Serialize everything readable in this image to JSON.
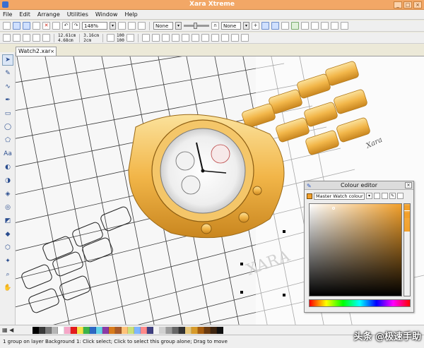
{
  "window": {
    "title": "Xara Xtreme",
    "controls": [
      "_",
      "□",
      "×"
    ]
  },
  "menu": [
    "File",
    "Edit",
    "Arrange",
    "Utilities",
    "Window",
    "Help"
  ],
  "toolbar1": {
    "zoom": "148%",
    "fill_a": "None",
    "fill_b": "None"
  },
  "toolbar2": {
    "x": "12.61cm",
    "y": "4.68cm",
    "w": "3.16cm",
    "h": "2cm",
    "sx": "100",
    "sy": "100"
  },
  "document_tab": {
    "label": "Watch2.xar",
    "close": "×"
  },
  "colour_editor": {
    "title": "Colour editor",
    "colour_name": "Master Watch colour",
    "close": "×"
  },
  "canvas": {
    "signature": "Xara",
    "watermark_text": "XARA"
  },
  "status": "1 group on layer Background 1: Click select; Click to select this group alone; Drag to move",
  "overlay": "头条 @极速手助",
  "colors": {
    "gold": "#f2a02b",
    "gold_light": "#fbd98c",
    "title_bar": "#f2a766"
  },
  "palette_colors": [
    "#000000",
    "#3a3a3a",
    "#7a7a7a",
    "#b5b5b5",
    "#ffffff",
    "#f6a7c8",
    "#e41b1b",
    "#f6e34a",
    "#3bb34a",
    "#2d68c4",
    "#65d3e8",
    "#8b3aa6",
    "#d87b1c",
    "#a85a2a",
    "#ffc37a",
    "#c9e07a",
    "#7fb6ff",
    "#ff8a8a",
    "#404080",
    "#f2f2f2",
    "#d0d0d0",
    "#9a9a9a",
    "#666666",
    "#333333",
    "#e7c77a",
    "#d79a2a",
    "#a65d10",
    "#6a3a10",
    "#3d2510",
    "#101010"
  ]
}
